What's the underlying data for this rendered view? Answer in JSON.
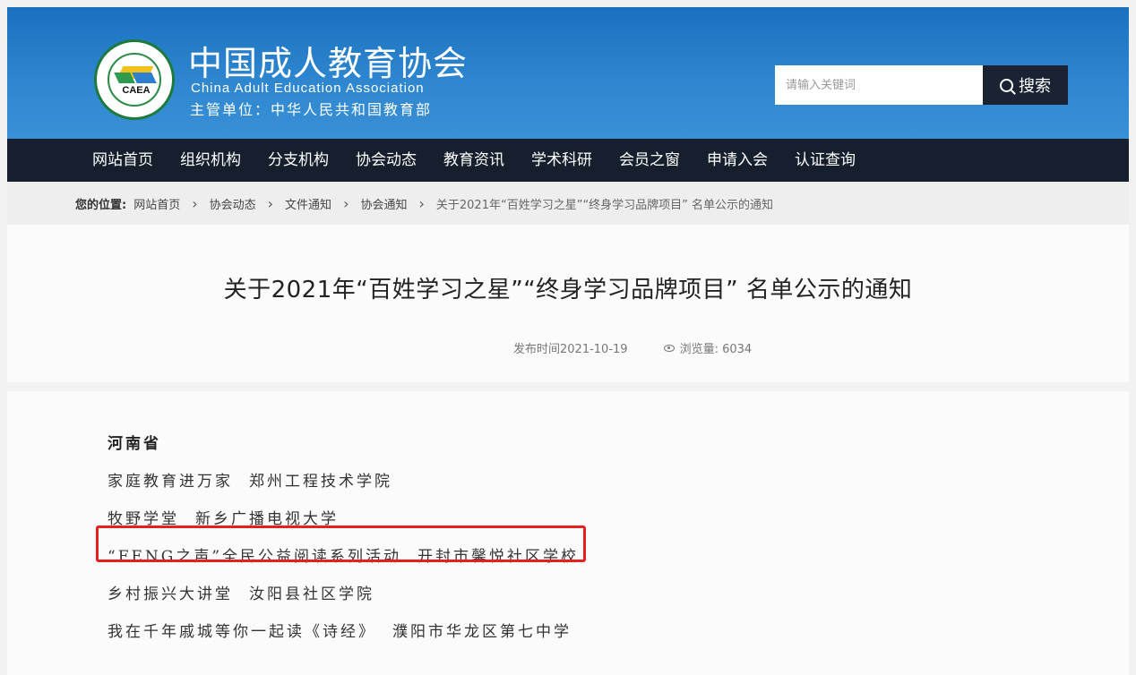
{
  "header": {
    "logo_text": "CAEA",
    "title": "中国成人教育协会",
    "subtitle": "China Adult Education Association",
    "supervisor": "主管单位：中华人民共和国教育部",
    "search_placeholder": "请输入关键词",
    "search_button": "搜索",
    "colors": {
      "header_blue": "#1b70be",
      "nav_dark": "#161f2e",
      "search_button": "#1a2334",
      "highlight_red": "#e42020"
    }
  },
  "nav": {
    "items": [
      "网站首页",
      "组织机构",
      "分支机构",
      "协会动态",
      "教育资讯",
      "学术科研",
      "会员之窗",
      "申请入会",
      "认证查询"
    ]
  },
  "breadcrumb": {
    "label": "您的位置:",
    "items": [
      "网站首页",
      "协会动态",
      "文件通知",
      "协会通知"
    ],
    "current": "关于2021年“百姓学习之星”“终身学习品牌项目” 名单公示的通知"
  },
  "article": {
    "title": "关于2021年“百姓学习之星”“终身学习品牌项目” 名单公示的通知",
    "publish_time": "发布时间2021-10-19",
    "views_label": "浏览量: 6034"
  },
  "content": {
    "province": "河南省",
    "entries": [
      {
        "project": "家庭教育进万家",
        "org": "郑州工程技术学院"
      },
      {
        "project": "牧野学堂",
        "org": "新乡广播电视大学"
      },
      {
        "project": "“FENG之声”全民公益阅读系列活动",
        "org": "开封市馨悦社区学校"
      },
      {
        "project": " 乡村振兴大讲堂",
        "org": "汝阳县社区学院"
      },
      {
        "project": "我在千年戚城等你一起读《诗经》",
        "org": "濮阳市华龙区第七中学"
      }
    ]
  }
}
